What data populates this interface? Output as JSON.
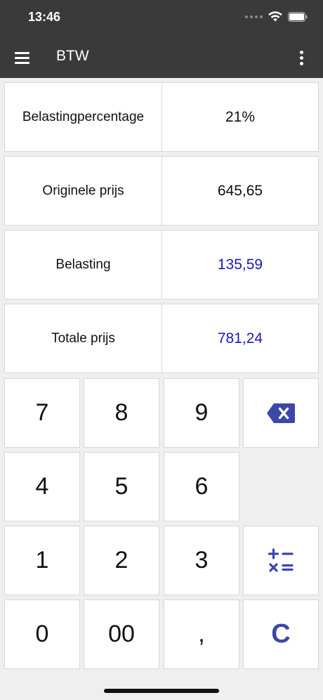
{
  "status": {
    "time": "13:46"
  },
  "appbar": {
    "title": "BTW"
  },
  "fields": [
    {
      "label": "Belastingpercentage",
      "value": "21%"
    },
    {
      "label": "Originele prijs",
      "value": "645,65"
    },
    {
      "label": "Belasting",
      "value": "135,59"
    },
    {
      "label": "Totale prijs",
      "value": "781,24"
    }
  ],
  "keypad": {
    "k7": "7",
    "k8": "8",
    "k9": "9",
    "k4": "4",
    "k5": "5",
    "k6": "6",
    "k1": "1",
    "k2": "2",
    "k3": "3",
    "k0": "0",
    "k00": "00",
    "comma": ",",
    "clear": "C",
    "backspace_icon": "backspace-icon",
    "operations_icon": "calculator-operations-icon"
  },
  "colors": {
    "appbar": "#3a3a3a",
    "result_text": "#1a1ab8",
    "accent": "#3b48a8"
  }
}
